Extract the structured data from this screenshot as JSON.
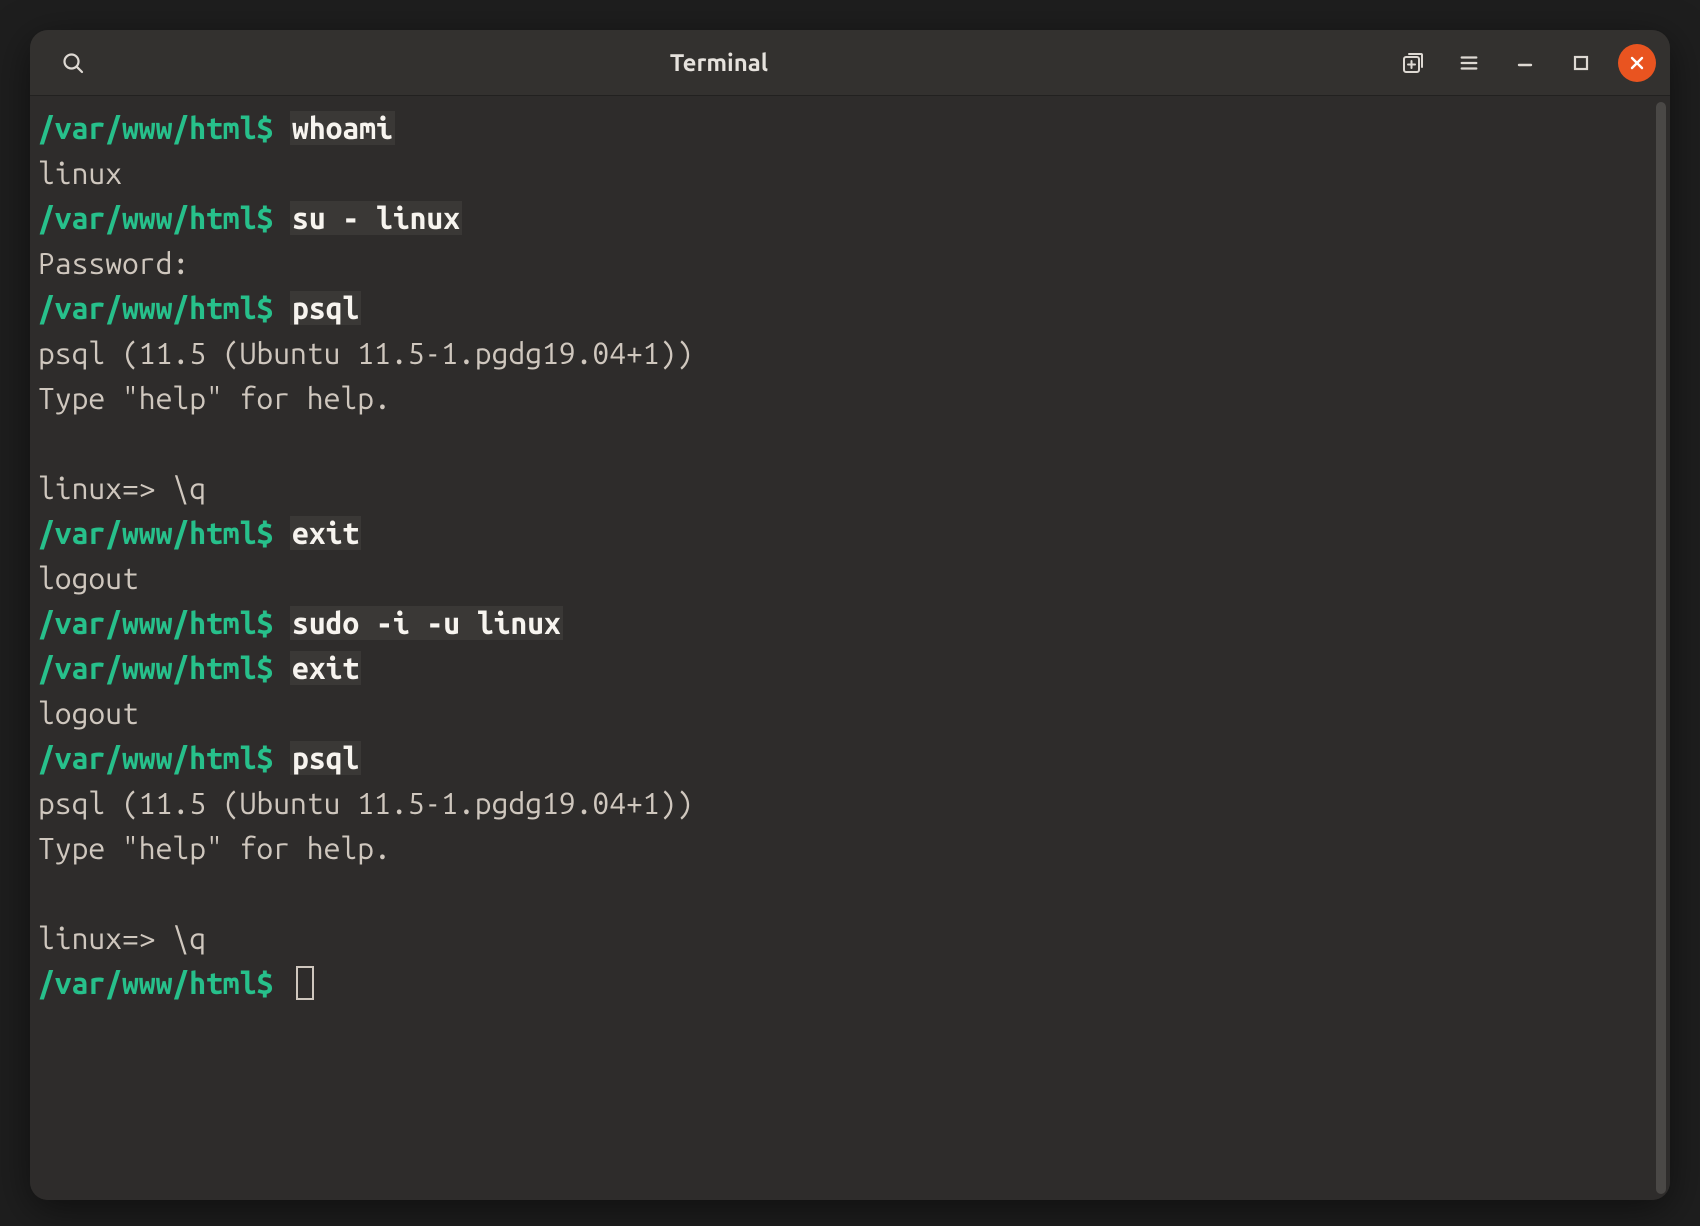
{
  "window": {
    "title": "Terminal"
  },
  "colors": {
    "prompt": "#27c08b",
    "cmd_bg": "#3a3836",
    "text": "#cfc7be",
    "close": "#e95420"
  },
  "prompt_path": "/var/www/html",
  "prompt_sigil": "$",
  "session": [
    {
      "type": "shell",
      "cmd": "whoami"
    },
    {
      "type": "out",
      "text": "linux"
    },
    {
      "type": "shell",
      "cmd": "su - linux"
    },
    {
      "type": "out",
      "text": "Password:"
    },
    {
      "type": "shell",
      "cmd": "psql"
    },
    {
      "type": "out",
      "text": "psql (11.5 (Ubuntu 11.5-1.pgdg19.04+1))"
    },
    {
      "type": "out",
      "text": "Type \"help\" for help."
    },
    {
      "type": "blank"
    },
    {
      "type": "psql",
      "prompt": "linux=>",
      "cmd": "\\q"
    },
    {
      "type": "shell",
      "cmd": "exit"
    },
    {
      "type": "out",
      "text": "logout"
    },
    {
      "type": "shell",
      "cmd": "sudo -i -u linux"
    },
    {
      "type": "shell",
      "cmd": "exit"
    },
    {
      "type": "out",
      "text": "logout"
    },
    {
      "type": "shell",
      "cmd": "psql"
    },
    {
      "type": "out",
      "text": "psql (11.5 (Ubuntu 11.5-1.pgdg19.04+1))"
    },
    {
      "type": "out",
      "text": "Type \"help\" for help."
    },
    {
      "type": "blank"
    },
    {
      "type": "psql",
      "prompt": "linux=>",
      "cmd": "\\q"
    },
    {
      "type": "shell-cursor"
    }
  ]
}
